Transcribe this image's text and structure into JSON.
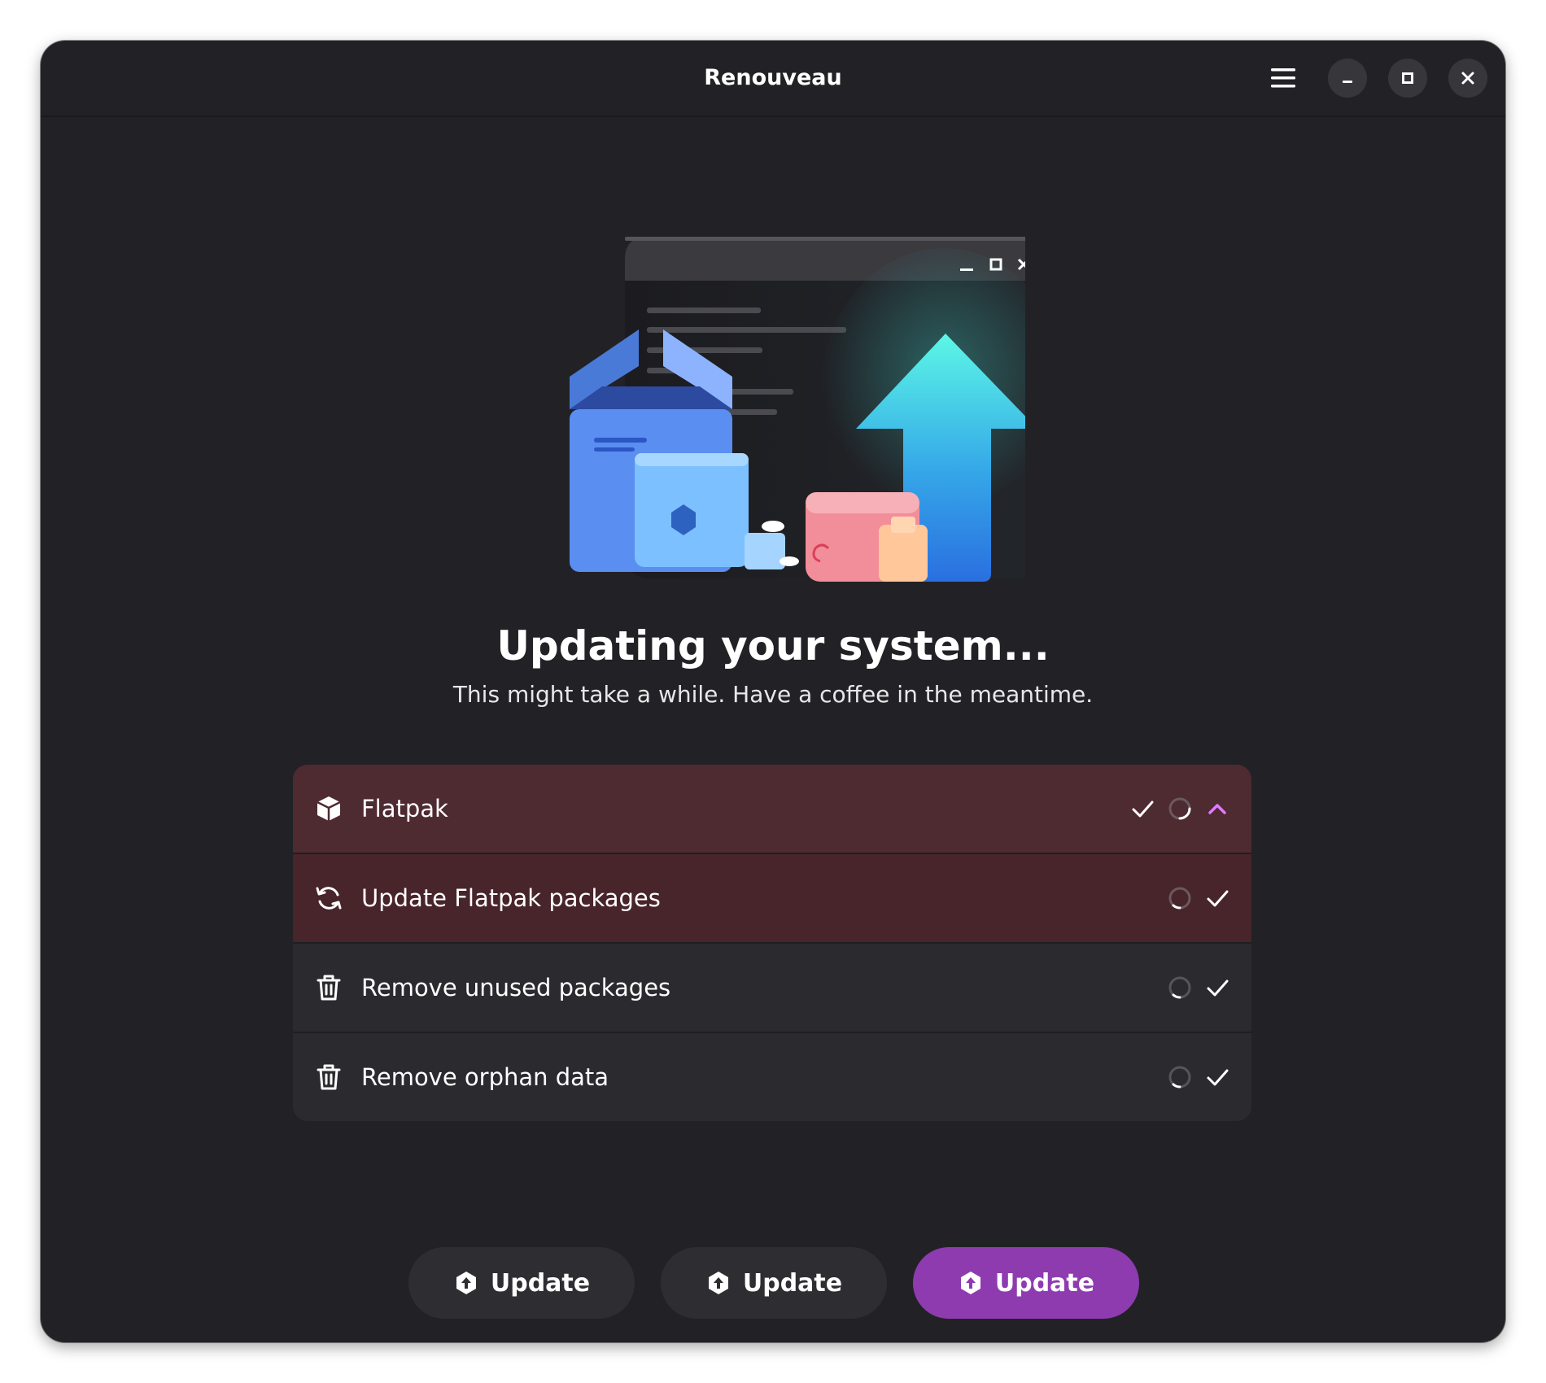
{
  "window": {
    "title": "Renouveau"
  },
  "header": {
    "menu_icon": "hamburger-menu-icon",
    "minimize_icon": "minimize-icon",
    "maximize_icon": "maximize-icon",
    "close_icon": "close-icon"
  },
  "main": {
    "heading": "Updating your system...",
    "subheading": "This might take a while. Have a coffee in the meantime."
  },
  "tasks": [
    {
      "label": "Flatpak",
      "icon": "package-icon",
      "status_icons": [
        "check-icon",
        "spinner-icon",
        "chevron-up-icon"
      ]
    },
    {
      "label": "Update Flatpak packages",
      "icon": "refresh-icon",
      "status_icons": [
        "spinner-icon",
        "check-icon"
      ]
    },
    {
      "label": "Remove unused packages",
      "icon": "trash-icon",
      "status_icons": [
        "spinner-icon",
        "check-icon"
      ]
    },
    {
      "label": "Remove orphan data",
      "icon": "trash-icon",
      "status_icons": [
        "spinner-icon",
        "check-icon"
      ]
    }
  ],
  "buttons": [
    {
      "label": "Update",
      "icon": "update-icon",
      "style": "default"
    },
    {
      "label": "Update",
      "icon": "update-icon",
      "style": "default"
    },
    {
      "label": "Update",
      "icon": "update-icon",
      "style": "suggested"
    }
  ],
  "colors": {
    "window_bg": "#222226",
    "accent": "#8e3bb0",
    "chevron_accent": "#e07aff",
    "row_active_bg": "#4e2a31",
    "row_sub_active_bg": "#48242b",
    "row_bg": "#2b2b2f",
    "button_bg": "#2e2e32"
  }
}
